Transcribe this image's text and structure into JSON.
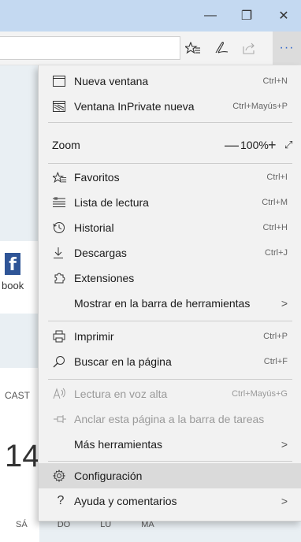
{
  "window": {
    "minimize_glyph": "—",
    "restore_glyph": "❐",
    "close_glyph": "✕"
  },
  "toolbar": {
    "icons": [
      "favorites-bar-icon",
      "pen-icon",
      "share-icon",
      "more-icon"
    ],
    "more_glyph": "···"
  },
  "background": {
    "card_label": "book",
    "cast_text": "CAST",
    "big_number": "14",
    "days": [
      "SÁ",
      "DO",
      "LU",
      "MA"
    ]
  },
  "menu": {
    "items": [
      {
        "label": "Nueva ventana",
        "shortcut": "Ctrl+N",
        "icon": "window-icon"
      },
      {
        "label": "Ventana InPrivate nueva",
        "shortcut": "Ctrl+Mayús+P",
        "icon": "inprivate-icon"
      },
      {
        "label": "Zoom",
        "zoom_value": "100%"
      },
      {
        "label": "Favoritos",
        "shortcut": "Ctrl+I",
        "icon": "favorites-icon"
      },
      {
        "label": "Lista de lectura",
        "shortcut": "Ctrl+M",
        "icon": "reading-list-icon"
      },
      {
        "label": "Historial",
        "shortcut": "Ctrl+H",
        "icon": "history-icon"
      },
      {
        "label": "Descargas",
        "shortcut": "Ctrl+J",
        "icon": "downloads-icon"
      },
      {
        "label": "Extensiones",
        "shortcut": "",
        "icon": "extensions-icon"
      },
      {
        "label": "Mostrar en la barra de herramientas",
        "shortcut": "",
        "arrow": ">"
      },
      {
        "label": "Imprimir",
        "shortcut": "Ctrl+P",
        "icon": "print-icon"
      },
      {
        "label": "Buscar en la página",
        "shortcut": "Ctrl+F",
        "icon": "search-icon"
      },
      {
        "label": "Lectura en voz alta",
        "shortcut": "Ctrl+Mayús+G",
        "icon": "read-aloud-icon",
        "disabled": true
      },
      {
        "label": "Anclar esta página a la barra de tareas",
        "shortcut": "",
        "icon": "pin-icon",
        "disabled": true
      },
      {
        "label": "Más herramientas",
        "arrow": ">"
      },
      {
        "label": "Configuración",
        "icon": "gear-icon",
        "highlighted": true
      },
      {
        "label": "Ayuda y comentarios",
        "icon": "help-icon",
        "arrow": ">"
      }
    ],
    "zoom_minus": "—",
    "zoom_plus": "+",
    "zoom_fullscreen": "⤢"
  }
}
